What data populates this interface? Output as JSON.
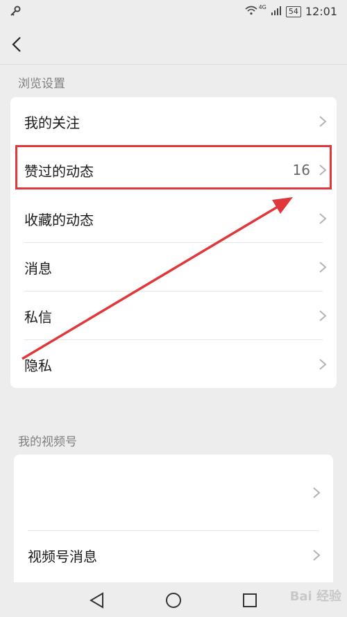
{
  "status": {
    "network": "4G",
    "battery": "54",
    "time": "12:01"
  },
  "browse": {
    "section_title": "浏览设置",
    "items": [
      {
        "label": "我的关注"
      },
      {
        "label": "赞过的动态",
        "count": "16"
      },
      {
        "label": "收藏的动态"
      },
      {
        "label": "消息"
      },
      {
        "label": "私信"
      },
      {
        "label": "隐私"
      }
    ]
  },
  "channels": {
    "section_title": "我的视频号",
    "items": [
      {
        "label": ""
      },
      {
        "label": "视频号消息"
      }
    ]
  },
  "annotation": {
    "highlight_color": "#e0373b"
  },
  "watermark": "Bai 经验"
}
